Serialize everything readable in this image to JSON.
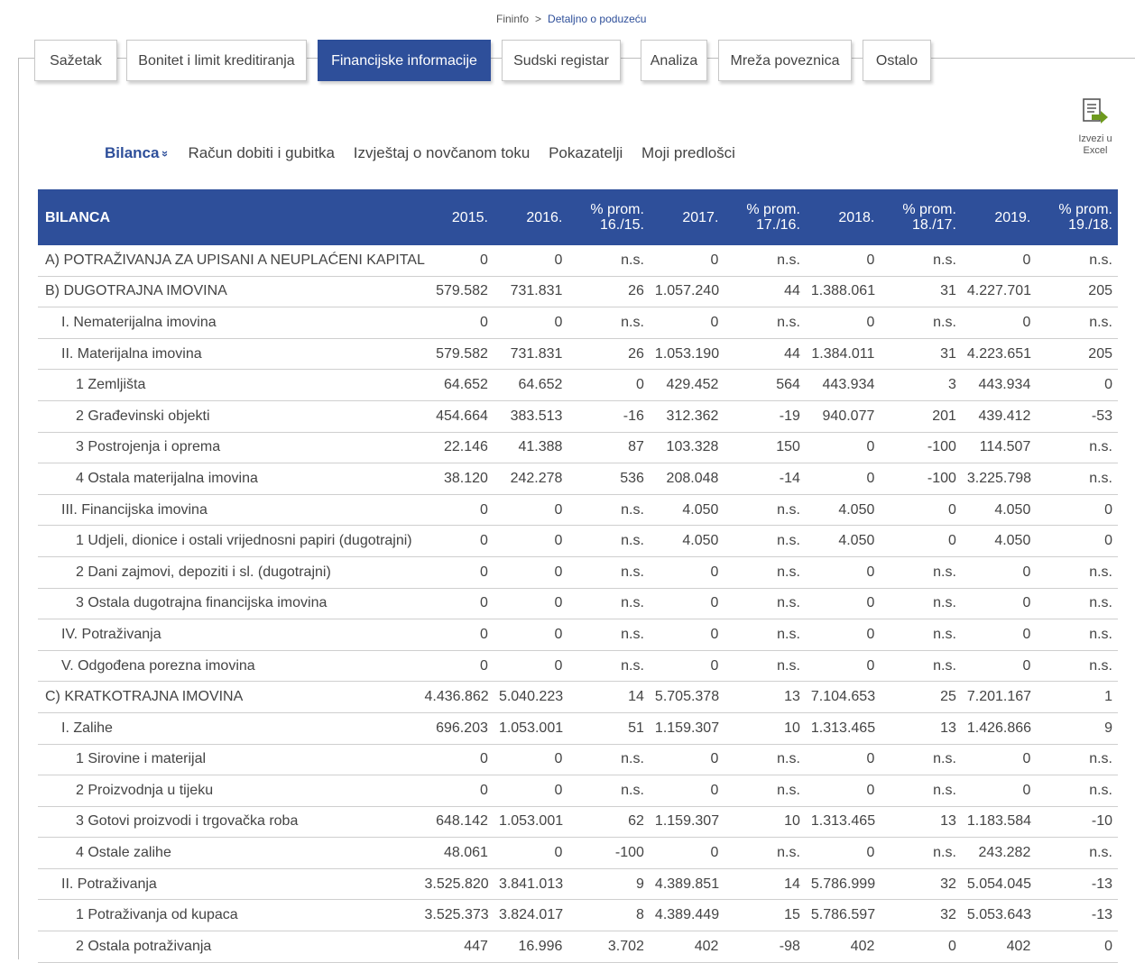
{
  "breadcrumb": {
    "root": "Fininfo",
    "separator": ">",
    "current": "Detaljno o poduzeću"
  },
  "tabs": [
    "Sažetak",
    "Bonitet i limit kreditiranja",
    "Financijske informacije",
    "Sudski registar",
    "Analiza",
    "Mreža poveznica",
    "Ostalo"
  ],
  "active_tab": "Financijske informacije",
  "export": {
    "label_line1": "Izvezi u",
    "label_line2": "Excel",
    "icon": "excel-export-icon"
  },
  "subnav": {
    "items": [
      "Bilanca",
      "Račun dobiti i gubitka",
      "Izvještaj o novčanom toku",
      "Pokazatelji",
      "Moji predlošci"
    ],
    "active": "Bilanca",
    "chevron": "»"
  },
  "table": {
    "headers": [
      "BILANCA",
      "2015.",
      "2016.",
      "% prom.\n16./15.",
      "2017.",
      "% prom.\n17./16.",
      "2018.",
      "% prom.\n18./17.",
      "2019.",
      "% prom.\n19./18."
    ],
    "rows": [
      {
        "label": "A) POTRAŽIVANJA ZA UPISANI A NEUPLAĆENI KAPITAL",
        "level": 0,
        "v": [
          "0",
          "0",
          "n.s.",
          "0",
          "n.s.",
          "0",
          "n.s.",
          "0",
          "n.s."
        ]
      },
      {
        "label": "B) DUGOTRAJNA IMOVINA",
        "level": 0,
        "v": [
          "579.582",
          "731.831",
          "26",
          "1.057.240",
          "44",
          "1.388.061",
          "31",
          "4.227.701",
          "205"
        ]
      },
      {
        "label": "I. Nematerijalna imovina",
        "level": 1,
        "v": [
          "0",
          "0",
          "n.s.",
          "0",
          "n.s.",
          "0",
          "n.s.",
          "0",
          "n.s."
        ]
      },
      {
        "label": "II. Materijalna imovina",
        "level": 1,
        "v": [
          "579.582",
          "731.831",
          "26",
          "1.053.190",
          "44",
          "1.384.011",
          "31",
          "4.223.651",
          "205"
        ]
      },
      {
        "label": "1 Zemljišta",
        "level": 2,
        "v": [
          "64.652",
          "64.652",
          "0",
          "429.452",
          "564",
          "443.934",
          "3",
          "443.934",
          "0"
        ]
      },
      {
        "label": "2 Građevinski objekti",
        "level": 2,
        "v": [
          "454.664",
          "383.513",
          "-16",
          "312.362",
          "-19",
          "940.077",
          "201",
          "439.412",
          "-53"
        ]
      },
      {
        "label": "3 Postrojenja i oprema",
        "level": 2,
        "v": [
          "22.146",
          "41.388",
          "87",
          "103.328",
          "150",
          "0",
          "-100",
          "114.507",
          "n.s."
        ]
      },
      {
        "label": "4 Ostala materijalna imovina",
        "level": 2,
        "v": [
          "38.120",
          "242.278",
          "536",
          "208.048",
          "-14",
          "0",
          "-100",
          "3.225.798",
          "n.s."
        ]
      },
      {
        "label": "III. Financijska imovina",
        "level": 1,
        "v": [
          "0",
          "0",
          "n.s.",
          "4.050",
          "n.s.",
          "4.050",
          "0",
          "4.050",
          "0"
        ]
      },
      {
        "label": "1 Udjeli, dionice i ostali vrijednosni papiri (dugotrajni)",
        "level": 2,
        "v": [
          "0",
          "0",
          "n.s.",
          "4.050",
          "n.s.",
          "4.050",
          "0",
          "4.050",
          "0"
        ]
      },
      {
        "label": "2 Dani zajmovi, depoziti i sl. (dugotrajni)",
        "level": 2,
        "v": [
          "0",
          "0",
          "n.s.",
          "0",
          "n.s.",
          "0",
          "n.s.",
          "0",
          "n.s."
        ]
      },
      {
        "label": "3 Ostala dugotrajna financijska imovina",
        "level": 2,
        "v": [
          "0",
          "0",
          "n.s.",
          "0",
          "n.s.",
          "0",
          "n.s.",
          "0",
          "n.s."
        ]
      },
      {
        "label": "IV. Potraživanja",
        "level": 1,
        "v": [
          "0",
          "0",
          "n.s.",
          "0",
          "n.s.",
          "0",
          "n.s.",
          "0",
          "n.s."
        ]
      },
      {
        "label": "V. Odgođena porezna imovina",
        "level": 1,
        "v": [
          "0",
          "0",
          "n.s.",
          "0",
          "n.s.",
          "0",
          "n.s.",
          "0",
          "n.s."
        ]
      },
      {
        "label": "C) KRATKOTRAJNA IMOVINA",
        "level": 0,
        "v": [
          "4.436.862",
          "5.040.223",
          "14",
          "5.705.378",
          "13",
          "7.104.653",
          "25",
          "7.201.167",
          "1"
        ]
      },
      {
        "label": "I. Zalihe",
        "level": 1,
        "v": [
          "696.203",
          "1.053.001",
          "51",
          "1.159.307",
          "10",
          "1.313.465",
          "13",
          "1.426.866",
          "9"
        ]
      },
      {
        "label": "1 Sirovine i materijal",
        "level": 2,
        "v": [
          "0",
          "0",
          "n.s.",
          "0",
          "n.s.",
          "0",
          "n.s.",
          "0",
          "n.s."
        ]
      },
      {
        "label": "2 Proizvodnja u tijeku",
        "level": 2,
        "v": [
          "0",
          "0",
          "n.s.",
          "0",
          "n.s.",
          "0",
          "n.s.",
          "0",
          "n.s."
        ]
      },
      {
        "label": "3 Gotovi proizvodi i trgovačka roba",
        "level": 2,
        "v": [
          "648.142",
          "1.053.001",
          "62",
          "1.159.307",
          "10",
          "1.313.465",
          "13",
          "1.183.584",
          "-10"
        ]
      },
      {
        "label": "4 Ostale zalihe",
        "level": 2,
        "v": [
          "48.061",
          "0",
          "-100",
          "0",
          "n.s.",
          "0",
          "n.s.",
          "243.282",
          "n.s."
        ]
      },
      {
        "label": "II. Potraživanja",
        "level": 1,
        "v": [
          "3.525.820",
          "3.841.013",
          "9",
          "4.389.851",
          "14",
          "5.786.999",
          "32",
          "5.054.045",
          "-13"
        ]
      },
      {
        "label": "1 Potraživanja od kupaca",
        "level": 2,
        "v": [
          "3.525.373",
          "3.824.017",
          "8",
          "4.389.449",
          "15",
          "5.786.597",
          "32",
          "5.053.643",
          "-13"
        ]
      },
      {
        "label": "2 Ostala potraživanja",
        "level": 2,
        "v": [
          "447",
          "16.996",
          "3.702",
          "402",
          "-98",
          "402",
          "0",
          "402",
          "0"
        ]
      }
    ]
  },
  "colors": {
    "accent": "#2e4f9a",
    "excel_green": "#6e9a1e"
  }
}
